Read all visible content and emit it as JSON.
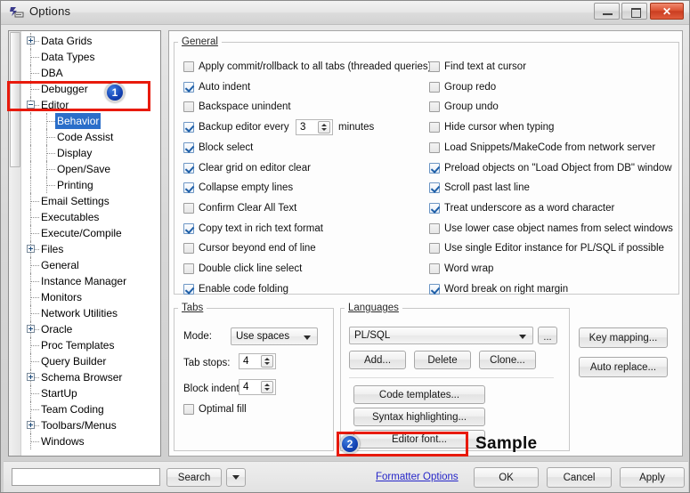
{
  "window": {
    "title": "Options",
    "icon": "options-window-icon",
    "controls": {
      "minimize": "minimize-button",
      "maximize": "maximize-button",
      "close": "✕"
    }
  },
  "tree": {
    "items": [
      {
        "label": "Data Grids",
        "indent": 0,
        "expander": "plus"
      },
      {
        "label": "Data Types",
        "indent": 0,
        "expander": "none"
      },
      {
        "label": "DBA",
        "indent": 0,
        "expander": "none"
      },
      {
        "label": "Debugger",
        "indent": 0,
        "expander": "none"
      },
      {
        "label": "Editor",
        "indent": 0,
        "expander": "minus"
      },
      {
        "label": "Behavior",
        "indent": 1,
        "expander": "none",
        "selected": true
      },
      {
        "label": "Code Assist",
        "indent": 1,
        "expander": "none"
      },
      {
        "label": "Display",
        "indent": 1,
        "expander": "none"
      },
      {
        "label": "Open/Save",
        "indent": 1,
        "expander": "none"
      },
      {
        "label": "Printing",
        "indent": 1,
        "expander": "none"
      },
      {
        "label": "Email Settings",
        "indent": 0,
        "expander": "none"
      },
      {
        "label": "Executables",
        "indent": 0,
        "expander": "none"
      },
      {
        "label": "Execute/Compile",
        "indent": 0,
        "expander": "none"
      },
      {
        "label": "Files",
        "indent": 0,
        "expander": "plus"
      },
      {
        "label": "General",
        "indent": 0,
        "expander": "none"
      },
      {
        "label": "Instance Manager",
        "indent": 0,
        "expander": "none"
      },
      {
        "label": "Monitors",
        "indent": 0,
        "expander": "none"
      },
      {
        "label": "Network Utilities",
        "indent": 0,
        "expander": "none"
      },
      {
        "label": "Oracle",
        "indent": 0,
        "expander": "plus"
      },
      {
        "label": "Proc Templates",
        "indent": 0,
        "expander": "none"
      },
      {
        "label": "Query Builder",
        "indent": 0,
        "expander": "none"
      },
      {
        "label": "Schema Browser",
        "indent": 0,
        "expander": "plus"
      },
      {
        "label": "StartUp",
        "indent": 0,
        "expander": "none"
      },
      {
        "label": "Team Coding",
        "indent": 0,
        "expander": "none"
      },
      {
        "label": "Toolbars/Menus",
        "indent": 0,
        "expander": "plus"
      },
      {
        "label": "Windows",
        "indent": 0,
        "expander": "none"
      }
    ]
  },
  "general": {
    "legend": "General",
    "left_column": [
      {
        "label": "Apply commit/rollback to all tabs (threaded queries)",
        "checked": false
      },
      {
        "label": "Auto indent",
        "checked": true
      },
      {
        "label": "Backspace unindent",
        "checked": false
      },
      {
        "label": "Backup editor every",
        "checked": true,
        "spinner": "3",
        "suffix": "minutes"
      },
      {
        "label": "Block select",
        "checked": true
      },
      {
        "label": "Clear grid on editor clear",
        "checked": true
      },
      {
        "label": "Collapse empty lines",
        "checked": true
      },
      {
        "label": "Confirm Clear All Text",
        "checked": false
      },
      {
        "label": "Copy text in rich text format",
        "checked": true
      },
      {
        "label": "Cursor beyond end of line",
        "checked": false
      },
      {
        "label": "Double click line select",
        "checked": false
      },
      {
        "label": "Enable code folding",
        "checked": true
      }
    ],
    "right_column": [
      {
        "label": "Find text at cursor",
        "checked": false
      },
      {
        "label": "Group redo",
        "checked": false
      },
      {
        "label": "Group undo",
        "checked": false
      },
      {
        "label": "Hide cursor when typing",
        "checked": false
      },
      {
        "label": "Load Snippets/MakeCode from network server",
        "checked": false
      },
      {
        "label": "Preload objects on \"Load Object from DB\" window",
        "checked": true
      },
      {
        "label": "Scroll past last line",
        "checked": true
      },
      {
        "label": "Treat underscore as a word character",
        "checked": true
      },
      {
        "label": "Use lower case object names from select windows",
        "checked": false
      },
      {
        "label": "Use single Editor instance for PL/SQL if possible",
        "checked": false
      },
      {
        "label": "Word wrap",
        "checked": false
      },
      {
        "label": "Word break on right margin",
        "checked": true
      }
    ]
  },
  "tabs": {
    "legend": "Tabs",
    "mode_label": "Mode:",
    "mode_value": "Use spaces",
    "tab_stops_label": "Tab stops:",
    "tab_stops_value": "4",
    "block_indent_label": "Block indent:",
    "block_indent_value": "4",
    "optimal_fill_label": "Optimal fill",
    "optimal_fill_checked": false
  },
  "languages": {
    "legend": "Languages",
    "selected": "PL/SQL",
    "ellipsis_button": "...",
    "add_button": "Add...",
    "delete_button": "Delete",
    "clone_button": "Clone...",
    "code_templates_button": "Code templates...",
    "syntax_highlighting_button": "Syntax highlighting...",
    "editor_font_button": "Editor font...",
    "sample_text": "Sample"
  },
  "side_buttons": {
    "key_mapping": "Key mapping...",
    "auto_replace": "Auto replace..."
  },
  "footer": {
    "search_value": "",
    "search_placeholder": "",
    "search_button": "Search",
    "dropdown_icon": "chevron-down-icon",
    "formatter_link": "Formatter Options",
    "ok_button": "OK",
    "cancel_button": "Cancel",
    "apply_button": "Apply"
  },
  "annotations": {
    "badge_1": "1",
    "badge_2": "2",
    "highlight_color": "#e81a0c"
  }
}
